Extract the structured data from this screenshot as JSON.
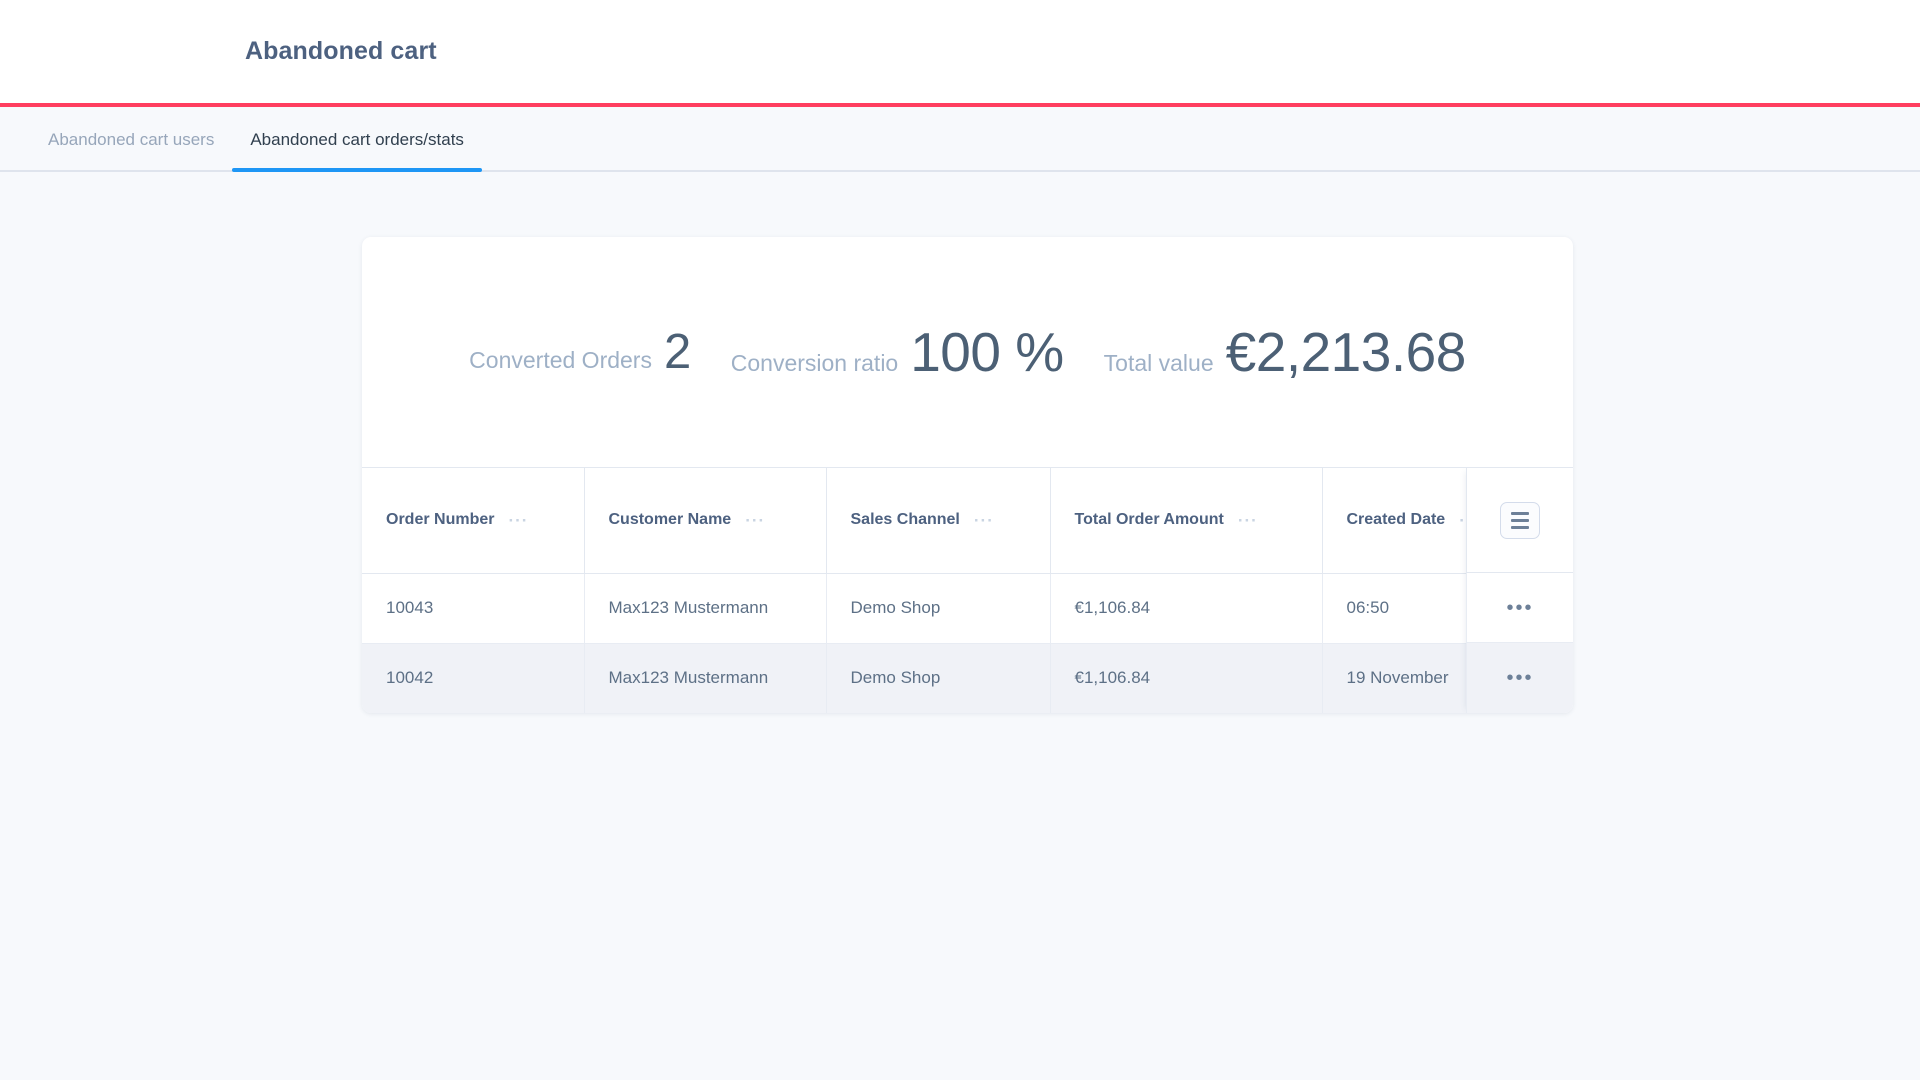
{
  "header": {
    "title": "Abandoned cart",
    "accent_color": "#ff3e5f"
  },
  "tabs": {
    "active_color": "#1e96f5",
    "items": [
      {
        "label": "Abandoned cart users",
        "active": false
      },
      {
        "label": "Abandoned cart orders/stats",
        "active": true
      }
    ]
  },
  "stats": [
    {
      "label": "Converted Orders",
      "value": "2"
    },
    {
      "label": "Conversion ratio",
      "value": "100 %"
    },
    {
      "label": "Total value",
      "value": "€2,213.68"
    }
  ],
  "table": {
    "columns": [
      {
        "label": "Order Number",
        "menu": "···"
      },
      {
        "label": "Customer Name",
        "menu": "···"
      },
      {
        "label": "Sales Channel",
        "menu": "···"
      },
      {
        "label": "Total Order Amount",
        "menu": "···"
      },
      {
        "label": "Created Date",
        "menu": "···"
      }
    ],
    "grid_menu_icon": "hamburger-icon",
    "row_menu_label": "•••",
    "rows": [
      {
        "order_number": "10043",
        "customer_name": "Max123 Mustermann",
        "sales_channel": "Demo Shop",
        "total_order_amount": "€1,106.84",
        "created_date": "06:50"
      },
      {
        "order_number": "10042",
        "customer_name": "Max123 Mustermann",
        "sales_channel": "Demo Shop",
        "total_order_amount": "€1,106.84",
        "created_date": "19 November"
      }
    ]
  }
}
